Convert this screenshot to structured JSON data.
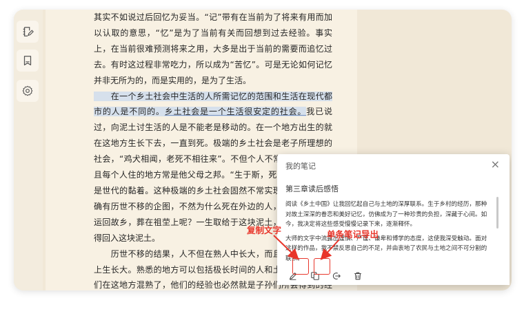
{
  "reader": {
    "paragraphs": [
      {
        "segments": [
          {
            "t": "其实不如说过后回忆为妥当。“记”带有在当前为了将来有用而加以认取的意思，“忆”是为了当前有关而回想到过去经验。事实上，在当前很难预测将来之用，大多是出于当前的需要而追忆过去。有时这过程非常吃力，所以成为“苦忆”。可是无论如何记忆并非无所为的，而是实用的，是为了生活。",
            "s": "n"
          }
        ]
      },
      {
        "segments": [
          {
            "t": "　　在一个乡土社会中生活的人所需记忆的范围和生活在现代都市的人是不同的。",
            "s": "h"
          },
          {
            "t": "乡土社会是一个生活很安定的社会。",
            "s": "hu"
          },
          {
            "t": "我已说过，向泥土讨生活的人是不能老是移动的。在一个地方出生的就在这地方生长下去，一直到死。极端的乡土社会是老子所理想的社会，“鸡犬相闻，老死不相往来”。不但个人不常抛井离乡，而且每个人住的地方常是他父母之邦。“生于斯，死于斯”的结果必是世代的黏着。这种极端的乡土社会固然不常实现，但是我们的确有历世不移的企图，不然为什么死在外边的人，一定要把棺材运回故乡，葬在祖茔上呢？一生取给于这块泥土，死了，骨肉还得回入这块泥土。",
            "s": "n"
          }
        ]
      },
      {
        "segments": [
          {
            "t": "　　历世不移的结果，人不但在熟人中长大，而且在熟悉的地方上生长大。熟悉的地方可以包括极长时间的人和土的混合。祖先们在这地方混熟了，他们的经验也必然就是子孙们所会得到的经验。时间的悠久是从谱系上说的，从每个人可能得到的经验说，却是同一方式的反复重演。",
            "s": "n"
          }
        ]
      }
    ]
  },
  "sidebar": {
    "items": [
      {
        "icon": "notes-edit-icon"
      },
      {
        "icon": "bookmark-icon"
      },
      {
        "icon": "gear-icon"
      }
    ]
  },
  "note_panel": {
    "title": "我的笔记",
    "close": "×",
    "chapter": "第三章读后感悟",
    "paragraphs": [
      "阅读《乡土中国》让我回忆起自己与土地的深厚联系。生于乡村的经历，那种对故土深深的眷恋和美好记忆，仿佛成为了一种珍贵的负担，深藏于心间。如今，我决定将这些感受慢慢记录下来，逐渐释怀。",
      "大师的文字中流露出谨慎、严谨、谦卑和博学的态度，这使我深受触动。面对这样的作品，我不禁反思自己的不足，并由衷地了农民与土地之间不可分割的联系。"
    ],
    "toolbar": [
      {
        "icon": "pen-icon"
      },
      {
        "icon": "copy-icon"
      },
      {
        "icon": "export-icon"
      },
      {
        "icon": "trash-icon"
      }
    ]
  },
  "annotations": {
    "copy_label": "复制文字",
    "export_label": "单条笔记导出",
    "color": "#e8352a"
  }
}
